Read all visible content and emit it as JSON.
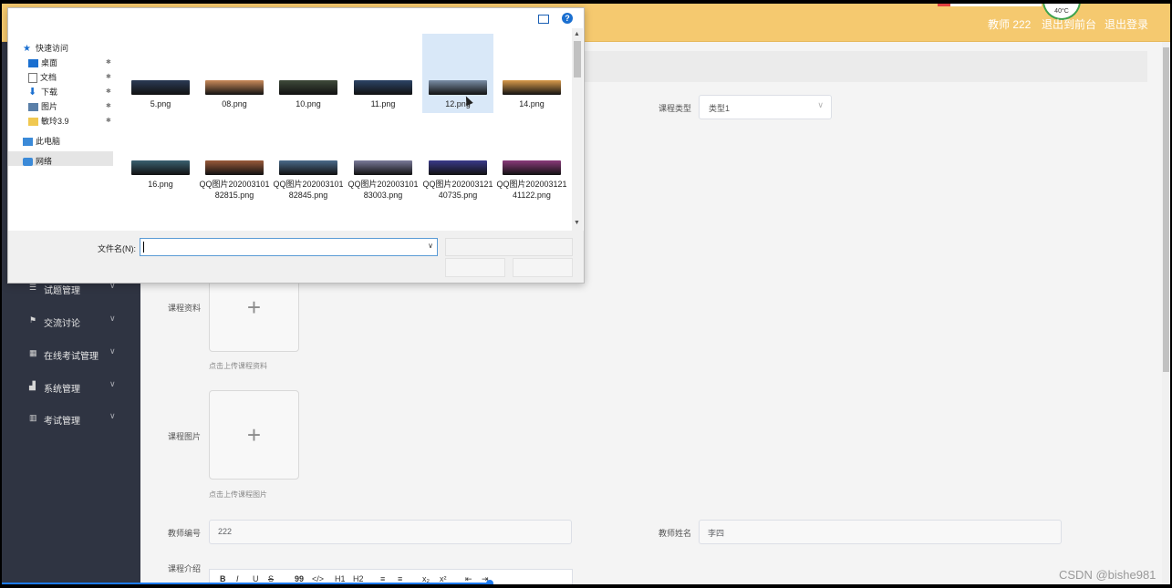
{
  "header": {
    "teacher_label": "教师 222",
    "exit_system": "退出到前台",
    "logout": "退出登录",
    "temperature": "40°C"
  },
  "sidebar": {
    "items": [
      {
        "label": "试题管理",
        "icon": "list-icon"
      },
      {
        "label": "交流讨论",
        "icon": "flag-icon"
      },
      {
        "label": "在线考试管理",
        "icon": "grid-icon"
      },
      {
        "label": "系统管理",
        "icon": "thumb-icon"
      },
      {
        "label": "考试管理",
        "icon": "bars-icon"
      }
    ]
  },
  "form": {
    "course_type_label": "课程类型",
    "course_type_value": "类型1",
    "course_material_label": "课程资料",
    "course_material_hint": "点击上传课程资料",
    "course_image_label": "课程图片",
    "course_image_hint": "点击上传课程图片",
    "teacher_id_label": "教师编号",
    "teacher_id_value": "222",
    "teacher_name_label": "教师姓名",
    "teacher_name_value": "李四",
    "course_intro_label": "课程介绍",
    "editor_tools": [
      "B",
      "I",
      "U",
      "S",
      "99",
      "</>",
      "H1",
      "H2",
      "≡",
      "≡",
      "x₂",
      "x²",
      "⇤",
      "⇥"
    ]
  },
  "dialog": {
    "nav": {
      "quick_access": "快速访问",
      "desktop": "桌面",
      "documents": "文档",
      "downloads": "下载",
      "pictures": "图片",
      "folder": "敏玲3.9",
      "this_pc": "此电脑",
      "network": "网络"
    },
    "files": [
      {
        "name": "5.png",
        "color": "#2b3a55"
      },
      {
        "name": "08.png",
        "color": "#c98a5a"
      },
      {
        "name": "10.png",
        "color": "#3f4a3a"
      },
      {
        "name": "11.png",
        "color": "#2c4466"
      },
      {
        "name": "12.png",
        "color": "#7a8ea6"
      },
      {
        "name": "14.png",
        "color": "#d89a4a"
      },
      {
        "name": "16.png",
        "color": "#3a6070"
      },
      {
        "name": "QQ图片20200310182815.png",
        "color": "#9a5a3a"
      },
      {
        "name": "QQ图片20200310182845.png",
        "color": "#4a6a8a"
      },
      {
        "name": "QQ图片20200310183003.png",
        "color": "#7a7a9a"
      },
      {
        "name": "QQ图片20200312140735.png",
        "color": "#3a3a8a"
      },
      {
        "name": "QQ图片20200312141122.png",
        "color": "#8a3a7a"
      }
    ],
    "filename_label": "文件名(N):",
    "filename_value": ""
  },
  "watermark": "CSDN @bishe981"
}
